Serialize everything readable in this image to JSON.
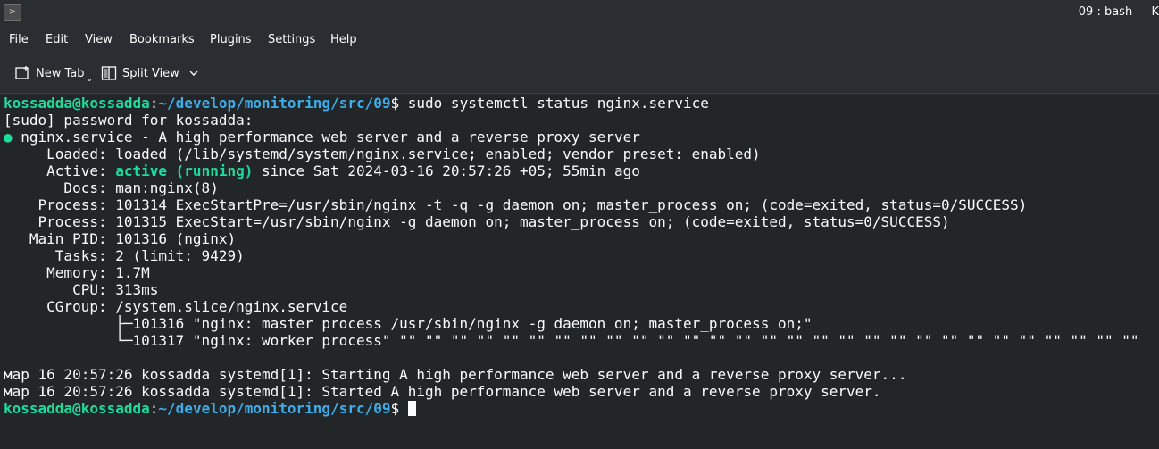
{
  "window": {
    "title": "09 : bash — K",
    "app_icon": "terminal-icon"
  },
  "menubar": {
    "items": [
      "File",
      "Edit",
      "View",
      "Bookmarks",
      "Plugins",
      "Settings",
      "Help"
    ]
  },
  "toolbar": {
    "new_tab_label": "New Tab",
    "split_view_label": "Split View"
  },
  "terminal": {
    "prompt_user": "kossadda@kossadda",
    "prompt_path": "~/develop/monitoring/src/09",
    "command": "sudo systemctl status nginx.service",
    "lines": {
      "sudo": "[sudo] password for kossadda:",
      "service_dot": "●",
      "service": " nginx.service - A high performance web server and a reverse proxy server",
      "loaded": "     Loaded: loaded (/lib/systemd/system/nginx.service; enabled; vendor preset: enabled)",
      "active_label": "     Active: ",
      "active_status": "active (running)",
      "active_since": " since Sat 2024-03-16 20:57:26 +05; 55min ago",
      "docs": "       Docs: man:nginx(8)",
      "process1": "    Process: 101314 ExecStartPre=/usr/sbin/nginx -t -q -g daemon on; master_process on; (code=exited, status=0/SUCCESS)",
      "process2": "    Process: 101315 ExecStart=/usr/sbin/nginx -g daemon on; master_process on; (code=exited, status=0/SUCCESS)",
      "main_pid": "   Main PID: 101316 (nginx)",
      "tasks": "      Tasks: 2 (limit: 9429)",
      "memory": "     Memory: 1.7M",
      "cpu": "        CPU: 313ms",
      "cgroup": "     CGroup: /system.slice/nginx.service",
      "cgroup_child1": "             ├─101316 \"nginx: master process /usr/sbin/nginx -g daemon on; master_process on;\"",
      "cgroup_child2": "             └─101317 \"nginx: worker process\" \"\" \"\" \"\" \"\" \"\" \"\" \"\" \"\" \"\" \"\" \"\" \"\" \"\" \"\" \"\" \"\" \"\" \"\" \"\" \"\" \"\" \"\" \"\" \"\" \"\" \"\" \"\" \"\" \"\"",
      "log1": "мар 16 20:57:26 kossadda systemd[1]: Starting A high performance web server and a reverse proxy server...",
      "log2": "мар 16 20:57:26 kossadda systemd[1]: Started A high performance web server and a reverse proxy server."
    },
    "prompt_sign": "$ "
  }
}
